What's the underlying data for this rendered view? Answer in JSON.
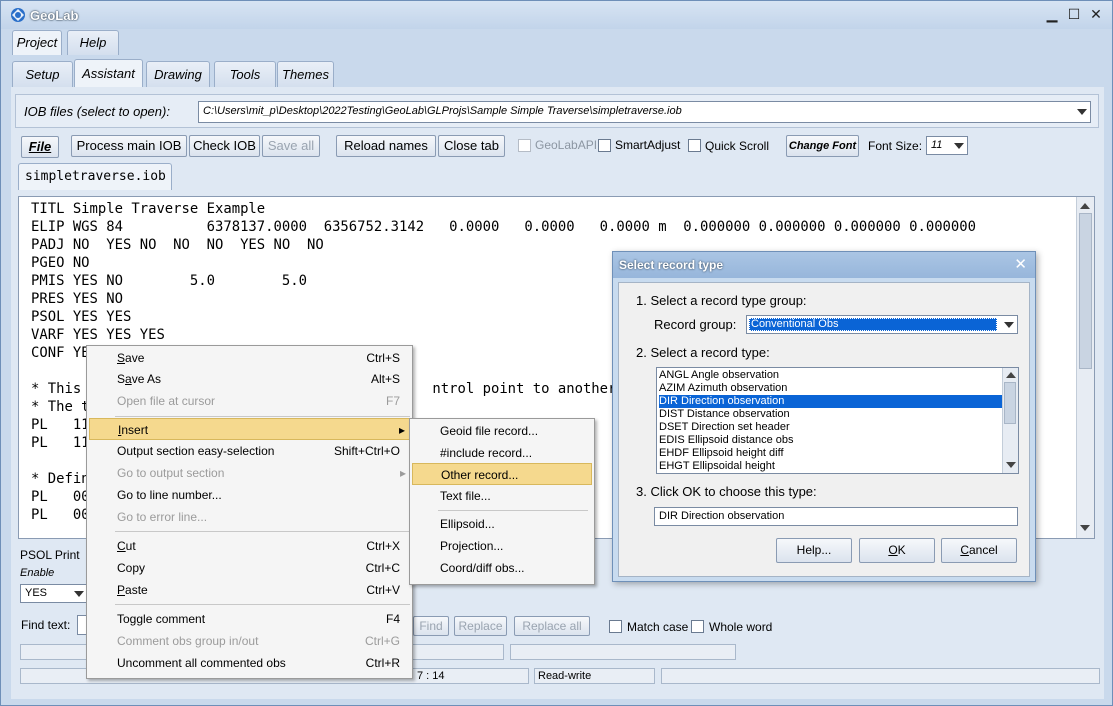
{
  "app": {
    "title": "GeoLab",
    "colors": {
      "accent": "#0a64d6",
      "menu_highlight": "#f5d98e"
    }
  },
  "menubar": {
    "project": "Project",
    "help": "Help"
  },
  "tabs": [
    {
      "label": "Setup"
    },
    {
      "label": "Assistant"
    },
    {
      "label": "Drawing"
    },
    {
      "label": "Tools"
    },
    {
      "label": "Themes"
    }
  ],
  "iob": {
    "label": "IOB files (select to open):",
    "path": "C:\\Users\\mit_p\\Desktop\\2022Testing\\GeoLab\\GLProjs\\Sample Simple Traverse\\simpletraverse.iob"
  },
  "toolbar": {
    "file": "File",
    "process": "Process main IOB",
    "check": "Check IOB",
    "save_all": "Save all",
    "reload": "Reload names",
    "close_tab": "Close tab",
    "geolabapi": "GeoLabAPI",
    "smartadjust": "SmartAdjust",
    "quickscroll": "Quick Scroll",
    "change_font": "Change Font",
    "font_size_label": "Font Size:",
    "font_size": "11"
  },
  "file_tab": "simpletraverse.iob",
  "editor": {
    "text": "TITL Simple Traverse Example\nELIP WGS 84          6378137.0000  6356752.3142   0.0000   0.0000   0.0000 m  0.000000 0.000000 0.000000 0.000000\nPADJ NO  YES NO  NO  NO  YES NO  NO\nPGEO NO\nPMIS YES NO        5.0        5.0\nPRES YES NO\nPSOL YES YES\nVARF YES YES YES\nCONF YE\n\n* This i                                        ntrol point to another.\n* The tw\nPL   11\nPL   11\n\n* Define\nPL   00\nPL   00"
  },
  "psol": {
    "label": "PSOL Print",
    "enable": "Enable",
    "value": "YES"
  },
  "find": {
    "label": "Find text:",
    "find_btn": "Find",
    "replace_btn": "Replace",
    "replace_all_btn": "Replace all",
    "match_case": "Match case",
    "whole_word": "Whole word"
  },
  "status": {
    "position": "7 : 14",
    "mode": "Read-write"
  },
  "context_menu": {
    "items": [
      {
        "label": "Save",
        "shortcut": "Ctrl+S"
      },
      {
        "label": "Save As",
        "shortcut": "Alt+S"
      },
      {
        "label": "Open file at cursor",
        "shortcut": "F7"
      },
      {
        "label": "Insert",
        "shortcut": "▸"
      },
      {
        "label": "Output section easy-selection",
        "shortcut": "Shift+Ctrl+O"
      },
      {
        "label": "Go to output section",
        "shortcut": "▸"
      },
      {
        "label": "Go to line number...",
        "shortcut": ""
      },
      {
        "label": "Go to error line...",
        "shortcut": ""
      },
      {
        "label": "Cut",
        "shortcut": "Ctrl+X"
      },
      {
        "label": "Copy",
        "shortcut": "Ctrl+C"
      },
      {
        "label": "Paste",
        "shortcut": "Ctrl+V"
      },
      {
        "label": "Toggle comment",
        "shortcut": "F4"
      },
      {
        "label": "Comment obs group in/out",
        "shortcut": "Ctrl+G"
      },
      {
        "label": "Uncomment all commented obs",
        "shortcut": "Ctrl+R"
      }
    ]
  },
  "submenu": {
    "items": [
      {
        "label": "Geoid file record..."
      },
      {
        "label": "#include record..."
      },
      {
        "label": "Other record..."
      },
      {
        "label": "Text file..."
      },
      {
        "label": "Ellipsoid..."
      },
      {
        "label": "Projection..."
      },
      {
        "label": "Coord/diff obs..."
      }
    ]
  },
  "dialog": {
    "title": "Select record type",
    "step1": "1. Select a record type group:",
    "group_label": "Record group:",
    "group_value": "Conventional Obs",
    "step2": "2. Select a record type:",
    "records": [
      "ANGL Angle observation",
      "AZIM Azimuth observation",
      "DIR  Direction observation",
      "DIST Distance observation",
      "DSET Direction set header",
      "EDIS Ellipsoid distance obs",
      "EHDF Ellipsoid height diff",
      "EHGT Ellipsoidal height"
    ],
    "step3": "3. Click OK to choose this type:",
    "chosen": "DIR  Direction observation",
    "help": "Help...",
    "ok": "OK",
    "cancel": "Cancel"
  }
}
